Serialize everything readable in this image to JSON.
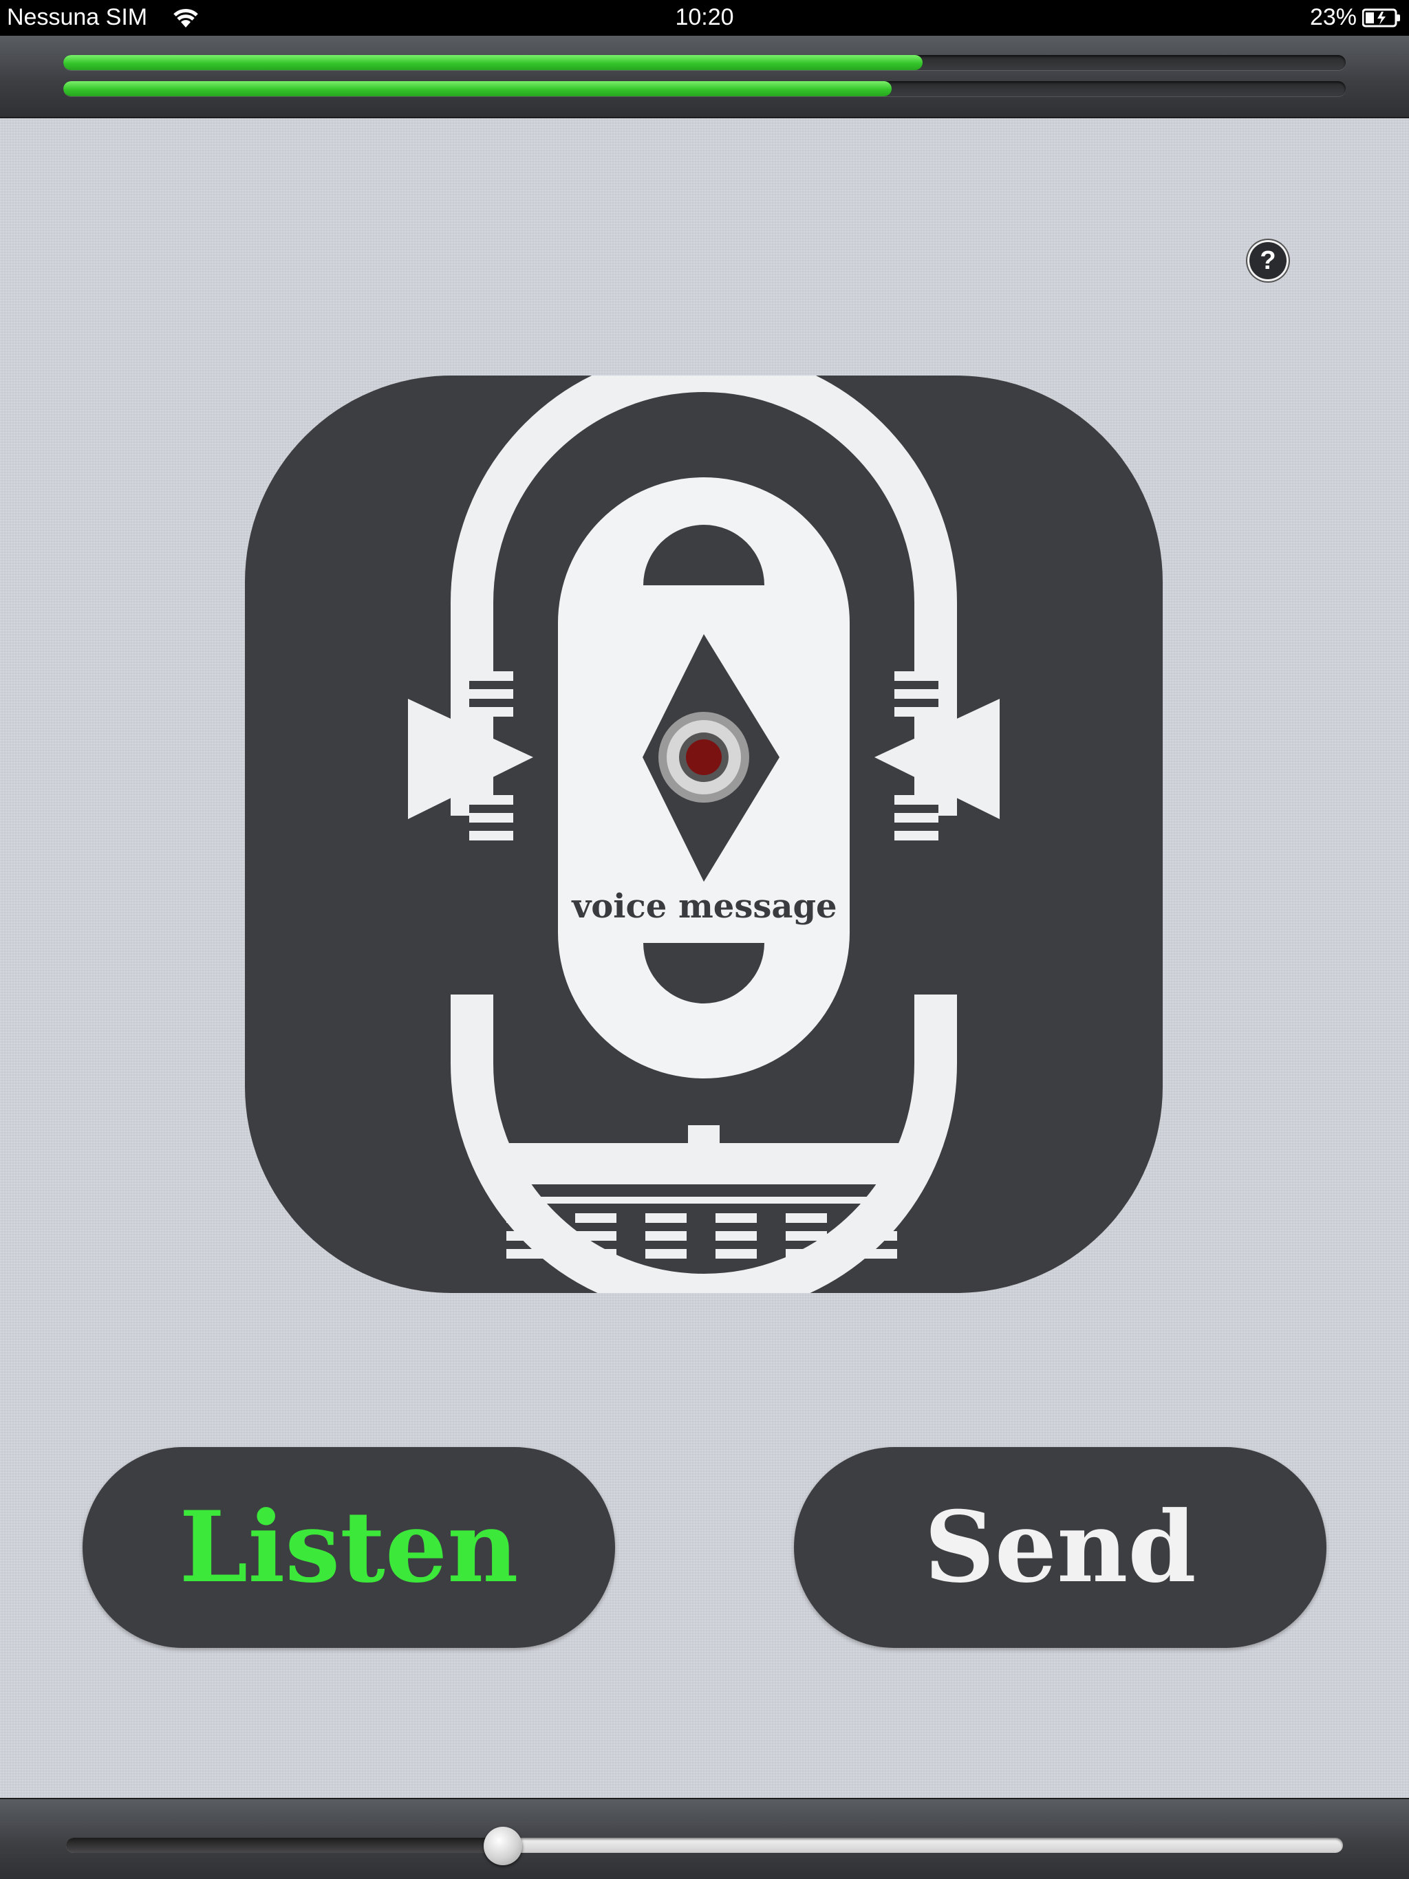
{
  "status_bar": {
    "carrier": "Nessuna SIM",
    "time": "10:20",
    "battery_percent": "23%"
  },
  "top_bar": {
    "progress_primary": 0.67,
    "progress_secondary": 0.646
  },
  "help": {
    "label": "?"
  },
  "logo": {
    "caption": "voice message",
    "icon": "microphone-icon"
  },
  "buttons": {
    "listen_label": "Listen",
    "send_label": "Send"
  },
  "bottom_bar": {
    "slider_value": 0.342
  },
  "colors": {
    "accent_green": "#3ce83a",
    "button_dark": "#3d3e41",
    "background": "#cfd2d9"
  }
}
